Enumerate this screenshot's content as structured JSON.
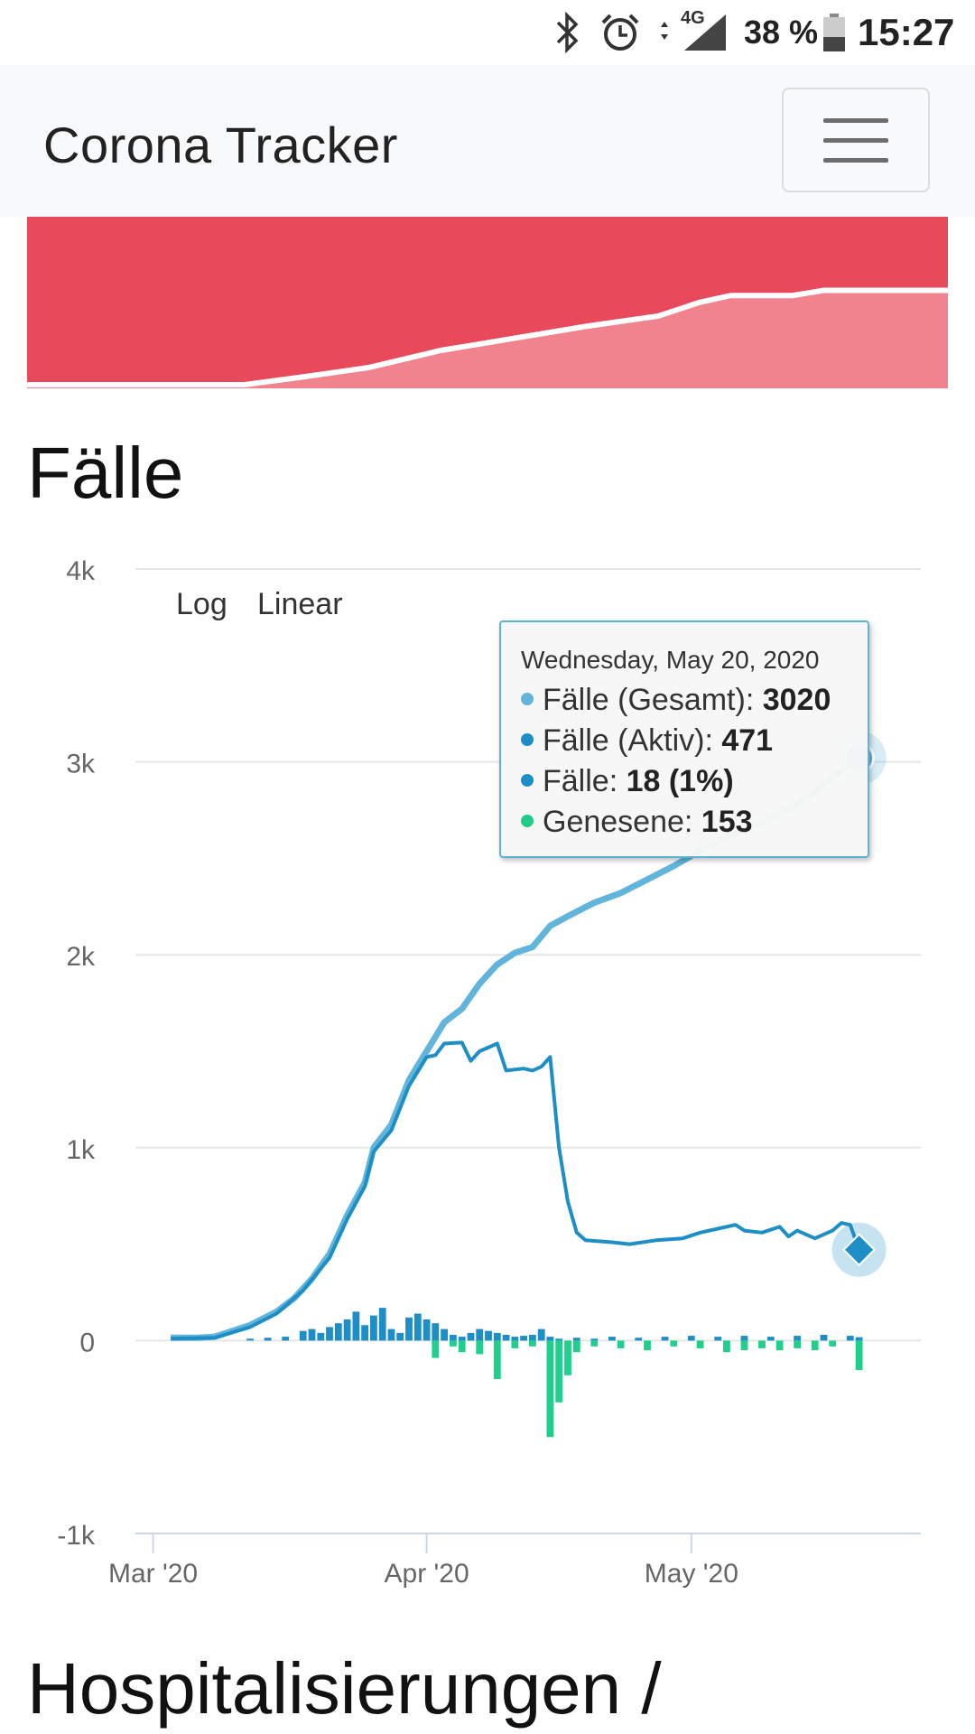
{
  "status_bar": {
    "battery_text": "38 %",
    "time": "15:27",
    "network": "4G",
    "icons": [
      "bluetooth-icon",
      "alarm-icon",
      "data-arrows-icon",
      "signal-icon",
      "battery-icon"
    ]
  },
  "navbar": {
    "brand": "Corona Tracker",
    "menu_icon": "hamburger-menu-icon"
  },
  "sections": {
    "faelle_title": "Fälle",
    "hosp_title": "Hospitalisierungen /"
  },
  "chart_controls": {
    "log_label": "Log",
    "linear_label": "Linear"
  },
  "tooltip": {
    "date": "Wednesday, May 20, 2020",
    "rows": [
      {
        "label": "Fälle (Gesamt): ",
        "value": "3020",
        "color": "#62b5da"
      },
      {
        "label": "Fälle (Aktiv): ",
        "value": "471",
        "color": "#1e8fc6"
      },
      {
        "label": "Fälle: ",
        "value": "18 (1%)",
        "color": "#1e8fc6"
      },
      {
        "label": "Genesene: ",
        "value": "153",
        "color": "#22cc88"
      }
    ]
  },
  "colors": {
    "mini_bg": "#e84a5c",
    "mini_fill": "#f0838e",
    "total_line": "#62b5da",
    "active_line": "#1e8fc6",
    "new_bar": "#1e8fc6",
    "recovered_bar": "#20cf8c",
    "grid": "#e6e6e6"
  },
  "chart_data": {
    "type": "line",
    "title": "",
    "xlabel": "",
    "ylabel": "",
    "ylim": [
      -1000,
      4000
    ],
    "y_ticks": [
      "4k",
      "3k",
      "2k",
      "1k",
      "0",
      "-1k"
    ],
    "y_tick_values": [
      4000,
      3000,
      2000,
      1000,
      0,
      -1000
    ],
    "x_ticks": [
      "Mar '20",
      "Apr '20",
      "May '20"
    ],
    "x_tick_dates": [
      "2020-03-01",
      "2020-04-01",
      "2020-05-01"
    ],
    "x_range": [
      "2020-02-28",
      "2020-05-27"
    ],
    "series": [
      {
        "name": "Fälle (Gesamt)",
        "kind": "line",
        "points": [
          [
            "2020-03-03",
            15
          ],
          [
            "2020-03-06",
            15
          ],
          [
            "2020-03-08",
            20
          ],
          [
            "2020-03-10",
            50
          ],
          [
            "2020-03-12",
            80
          ],
          [
            "2020-03-15",
            150
          ],
          [
            "2020-03-17",
            220
          ],
          [
            "2020-03-19",
            320
          ],
          [
            "2020-03-21",
            450
          ],
          [
            "2020-03-23",
            650
          ],
          [
            "2020-03-25",
            820
          ],
          [
            "2020-03-26",
            1000
          ],
          [
            "2020-03-28",
            1120
          ],
          [
            "2020-03-30",
            1350
          ],
          [
            "2020-04-01",
            1500
          ],
          [
            "2020-04-03",
            1650
          ],
          [
            "2020-04-05",
            1720
          ],
          [
            "2020-04-07",
            1850
          ],
          [
            "2020-04-09",
            1950
          ],
          [
            "2020-04-11",
            2010
          ],
          [
            "2020-04-13",
            2040
          ],
          [
            "2020-04-15",
            2150
          ],
          [
            "2020-04-17",
            2200
          ],
          [
            "2020-04-20",
            2270
          ],
          [
            "2020-04-23",
            2320
          ],
          [
            "2020-04-26",
            2390
          ],
          [
            "2020-04-29",
            2460
          ],
          [
            "2020-05-02",
            2540
          ],
          [
            "2020-05-05",
            2610
          ],
          [
            "2020-05-08",
            2670
          ],
          [
            "2020-05-11",
            2730
          ],
          [
            "2020-05-14",
            2810
          ],
          [
            "2020-05-17",
            2920
          ],
          [
            "2020-05-20",
            3020
          ]
        ]
      },
      {
        "name": "Fälle (Aktiv)",
        "kind": "line",
        "points": [
          [
            "2020-03-03",
            10
          ],
          [
            "2020-03-08",
            15
          ],
          [
            "2020-03-12",
            70
          ],
          [
            "2020-03-15",
            140
          ],
          [
            "2020-03-18",
            260
          ],
          [
            "2020-03-21",
            430
          ],
          [
            "2020-03-23",
            630
          ],
          [
            "2020-03-25",
            800
          ],
          [
            "2020-03-26",
            980
          ],
          [
            "2020-03-28",
            1090
          ],
          [
            "2020-03-30",
            1320
          ],
          [
            "2020-04-01",
            1470
          ],
          [
            "2020-04-02",
            1480
          ],
          [
            "2020-04-03",
            1540
          ],
          [
            "2020-04-05",
            1545
          ],
          [
            "2020-04-06",
            1450
          ],
          [
            "2020-04-07",
            1500
          ],
          [
            "2020-04-09",
            1540
          ],
          [
            "2020-04-10",
            1400
          ],
          [
            "2020-04-12",
            1410
          ],
          [
            "2020-04-13",
            1400
          ],
          [
            "2020-04-14",
            1420
          ],
          [
            "2020-04-15",
            1470
          ],
          [
            "2020-04-16",
            1000
          ],
          [
            "2020-04-17",
            720
          ],
          [
            "2020-04-18",
            560
          ],
          [
            "2020-04-19",
            520
          ],
          [
            "2020-04-22",
            510
          ],
          [
            "2020-04-24",
            500
          ],
          [
            "2020-04-27",
            520
          ],
          [
            "2020-04-30",
            530
          ],
          [
            "2020-05-02",
            560
          ],
          [
            "2020-05-04",
            580
          ],
          [
            "2020-05-06",
            600
          ],
          [
            "2020-05-07",
            570
          ],
          [
            "2020-05-09",
            560
          ],
          [
            "2020-05-11",
            590
          ],
          [
            "2020-05-12",
            540
          ],
          [
            "2020-05-13",
            570
          ],
          [
            "2020-05-15",
            530
          ],
          [
            "2020-05-17",
            570
          ],
          [
            "2020-05-18",
            610
          ],
          [
            "2020-05-19",
            600
          ],
          [
            "2020-05-20",
            471
          ]
        ]
      },
      {
        "name": "Fälle",
        "kind": "bar",
        "points": [
          [
            "2020-03-12",
            10
          ],
          [
            "2020-03-14",
            15
          ],
          [
            "2020-03-16",
            20
          ],
          [
            "2020-03-18",
            50
          ],
          [
            "2020-03-19",
            60
          ],
          [
            "2020-03-20",
            40
          ],
          [
            "2020-03-21",
            70
          ],
          [
            "2020-03-22",
            90
          ],
          [
            "2020-03-23",
            110
          ],
          [
            "2020-03-24",
            150
          ],
          [
            "2020-03-25",
            80
          ],
          [
            "2020-03-26",
            130
          ],
          [
            "2020-03-27",
            170
          ],
          [
            "2020-03-28",
            60
          ],
          [
            "2020-03-29",
            40
          ],
          [
            "2020-03-30",
            120
          ],
          [
            "2020-03-31",
            140
          ],
          [
            "2020-04-01",
            110
          ],
          [
            "2020-04-02",
            90
          ],
          [
            "2020-04-03",
            60
          ],
          [
            "2020-04-04",
            30
          ],
          [
            "2020-04-05",
            20
          ],
          [
            "2020-04-06",
            40
          ],
          [
            "2020-04-07",
            60
          ],
          [
            "2020-04-08",
            50
          ],
          [
            "2020-04-09",
            40
          ],
          [
            "2020-04-10",
            30
          ],
          [
            "2020-04-11",
            20
          ],
          [
            "2020-04-12",
            25
          ],
          [
            "2020-04-13",
            30
          ],
          [
            "2020-04-14",
            60
          ],
          [
            "2020-04-15",
            20
          ],
          [
            "2020-04-16",
            10
          ],
          [
            "2020-04-18",
            15
          ],
          [
            "2020-04-20",
            10
          ],
          [
            "2020-04-22",
            20
          ],
          [
            "2020-04-25",
            15
          ],
          [
            "2020-04-28",
            20
          ],
          [
            "2020-05-01",
            25
          ],
          [
            "2020-05-04",
            20
          ],
          [
            "2020-05-07",
            25
          ],
          [
            "2020-05-10",
            20
          ],
          [
            "2020-05-13",
            25
          ],
          [
            "2020-05-16",
            30
          ],
          [
            "2020-05-19",
            25
          ],
          [
            "2020-05-20",
            18
          ]
        ]
      },
      {
        "name": "Genesene",
        "kind": "bar",
        "points": [
          [
            "2020-04-02",
            -90
          ],
          [
            "2020-04-04",
            -30
          ],
          [
            "2020-04-05",
            -60
          ],
          [
            "2020-04-07",
            -70
          ],
          [
            "2020-04-09",
            -200
          ],
          [
            "2020-04-11",
            -40
          ],
          [
            "2020-04-13",
            -30
          ],
          [
            "2020-04-15",
            -500
          ],
          [
            "2020-04-16",
            -320
          ],
          [
            "2020-04-17",
            -180
          ],
          [
            "2020-04-18",
            -60
          ],
          [
            "2020-04-20",
            -30
          ],
          [
            "2020-04-23",
            -40
          ],
          [
            "2020-04-26",
            -50
          ],
          [
            "2020-04-29",
            -30
          ],
          [
            "2020-05-02",
            -40
          ],
          [
            "2020-05-05",
            -60
          ],
          [
            "2020-05-07",
            -50
          ],
          [
            "2020-05-09",
            -40
          ],
          [
            "2020-05-11",
            -50
          ],
          [
            "2020-05-13",
            -40
          ],
          [
            "2020-05-15",
            -50
          ],
          [
            "2020-05-17",
            -30
          ],
          [
            "2020-05-20",
            -153
          ]
        ]
      }
    ]
  },
  "mini_chart_data": {
    "type": "area",
    "x_range": [
      "2020-02-28",
      "2020-05-27"
    ],
    "points": [
      [
        "2020-02-28",
        0
      ],
      [
        "2020-03-20",
        0
      ],
      [
        "2020-03-25",
        4
      ],
      [
        "2020-04-01",
        10
      ],
      [
        "2020-04-08",
        20
      ],
      [
        "2020-04-15",
        27
      ],
      [
        "2020-04-22",
        34
      ],
      [
        "2020-04-29",
        40
      ],
      [
        "2020-05-03",
        48
      ],
      [
        "2020-05-06",
        52
      ],
      [
        "2020-05-12",
        52
      ],
      [
        "2020-05-15",
        55
      ],
      [
        "2020-05-27",
        55
      ]
    ]
  }
}
